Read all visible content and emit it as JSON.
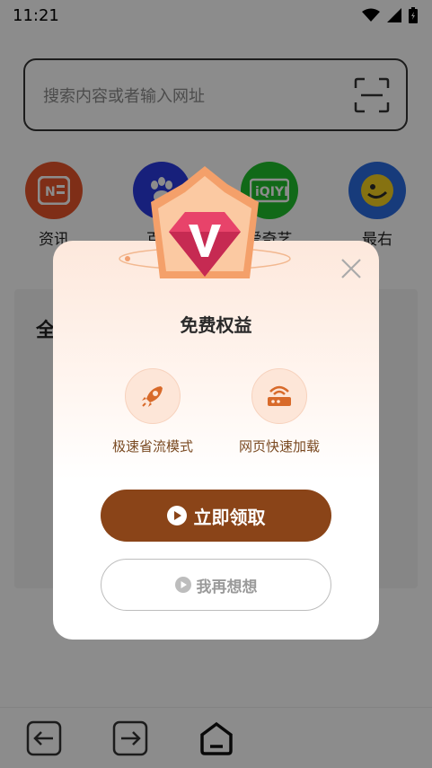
{
  "status_bar": {
    "time": "11:21"
  },
  "search": {
    "placeholder": "搜索内容或者输入网址"
  },
  "shortcuts": [
    {
      "label": "资讯",
      "icon": "news-icon",
      "color": "#e8542a"
    },
    {
      "label": "百度",
      "icon": "baidu-paw-icon",
      "color": "#2b3be0"
    },
    {
      "label": "爱奇艺",
      "icon": "iqiyi-icon",
      "color": "#1fbf2d"
    },
    {
      "label": "最右",
      "icon": "zuiyou-icon",
      "color": "#2a6ce0"
    }
  ],
  "card": {
    "title_char": "全"
  },
  "dialog": {
    "title": "免费权益",
    "features": [
      {
        "label": "极速省流模式",
        "icon": "rocket-icon"
      },
      {
        "label": "网页快速加载",
        "icon": "router-icon"
      }
    ],
    "primary_label": "立即领取",
    "secondary_label": "我再想想",
    "accent_color": "#8a4418"
  }
}
